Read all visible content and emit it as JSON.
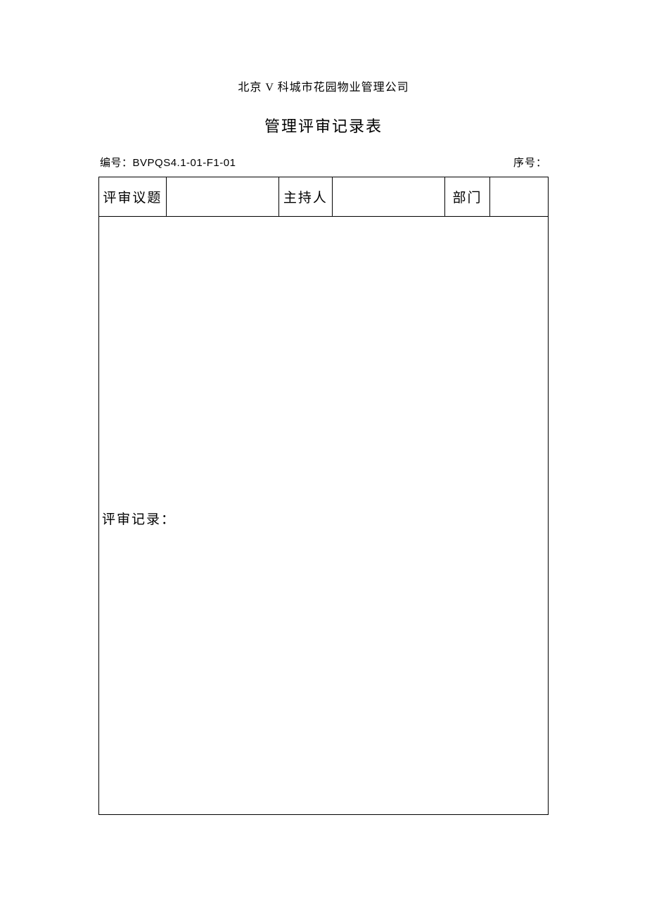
{
  "company_name": "北京 V 科城市花园物业管理公司",
  "doc_title": "管理评审记录表",
  "meta": {
    "code_label": "编号：",
    "code_value": "BVPQS4.1-01-F1-01",
    "seq_label": "序号：",
    "seq_value": ""
  },
  "form": {
    "topic_label": "评审议题",
    "topic_value": "",
    "host_label": "主持人",
    "host_value": "",
    "dept_label": "部门",
    "dept_value": "",
    "record_label": "评审记录：",
    "record_value": ""
  }
}
